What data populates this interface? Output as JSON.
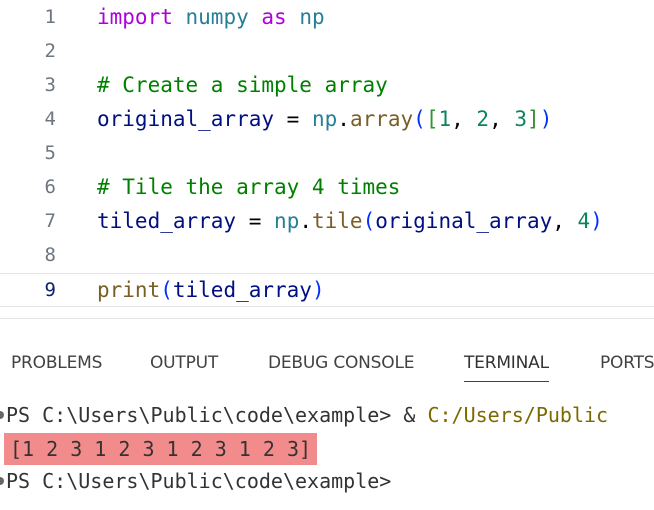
{
  "editor": {
    "lines": [
      {
        "num": "1",
        "tokens": [
          "import",
          "numpy",
          "as",
          "np"
        ]
      },
      {
        "num": "2"
      },
      {
        "num": "3",
        "comment": "# Create a simple array"
      },
      {
        "num": "4",
        "tokens": [
          "original_array",
          "=",
          "np",
          ".",
          "array",
          "(",
          "[",
          "1",
          ", ",
          "2",
          ", ",
          "3",
          "]",
          ")"
        ]
      },
      {
        "num": "5"
      },
      {
        "num": "6",
        "comment": "# Tile the array 4 times"
      },
      {
        "num": "7",
        "tokens": [
          "tiled_array",
          "=",
          "np",
          ".",
          "tile",
          "(",
          "original_array",
          ", ",
          "4",
          ")"
        ]
      },
      {
        "num": "8"
      },
      {
        "num": "9",
        "tokens": [
          "print",
          "(",
          "tiled_array",
          ")"
        ]
      }
    ]
  },
  "panel": {
    "tabs": [
      {
        "label": "PROBLEMS"
      },
      {
        "label": "OUTPUT"
      },
      {
        "label": "DEBUG CONSOLE"
      },
      {
        "label": "TERMINAL",
        "active": true
      },
      {
        "label": "PORTS"
      }
    ]
  },
  "terminal": {
    "line1_prompt": "PS C:\\Users\\Public\\code\\example>",
    "line1_amp": "&",
    "line1_path": "C:/Users/Public",
    "output": "[1 2 3 1 2 3 1 2 3 1 2 3]",
    "line3_prompt": "PS C:\\Users\\Public\\code\\example>"
  },
  "colors": {
    "keyword": "#af00db",
    "module": "#267f99",
    "variable": "#001080",
    "function": "#795e26",
    "number": "#098658",
    "comment": "#008000",
    "highlight": "#f28b8b"
  }
}
